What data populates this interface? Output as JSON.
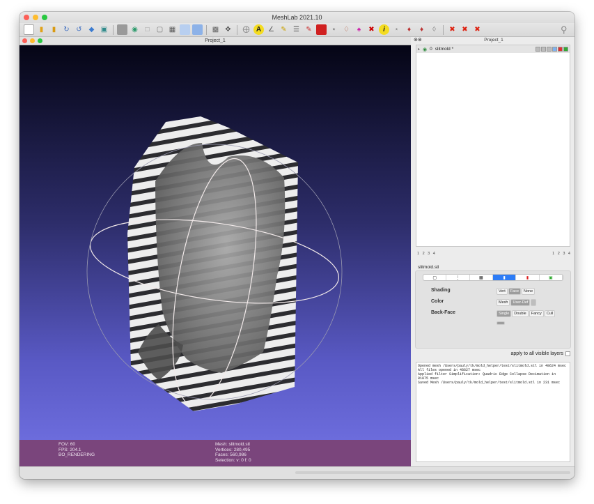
{
  "app": {
    "title": "MeshLab 2021.10"
  },
  "toolbar": {
    "icons": [
      "new-icon",
      "open-icon",
      "open-project-icon",
      "reload-icon",
      "reload-all-icon",
      "import-icon",
      "snapshot-icon",
      "points-icon",
      "wireframe-icon",
      "hidden-lines-icon",
      "flat-icon",
      "smooth-icon",
      "texture-icon",
      "box-icon",
      "bbox-icon",
      "lighting-icon",
      "align-icon",
      "annotation-icon",
      "measure-icon",
      "pick-icon",
      "paint-icon",
      "select-faces-icon",
      "select-vertices-icon",
      "z-paint-icon",
      "color-icon",
      "info-icon",
      "select-connected-icon",
      "delete-faces-icon",
      "delete-vertices-icon",
      "delete-all-icon",
      "x-icon",
      "search-icon"
    ]
  },
  "viewport": {
    "title": "Project_1",
    "info_left": [
      "FOV: 60",
      "FPS:   204.1",
      "BO_RENDERING"
    ],
    "info_right": [
      "Mesh: slitmold.stl",
      "Vertices: 280,495",
      "Faces: 560,986",
      "Selection: v: 0 f: 0"
    ]
  },
  "layers_panel": {
    "title": "Project_1",
    "layer": {
      "index": "0",
      "name": "slitmold *"
    },
    "pages_left": "1 2 3 4",
    "pages_right": "1 2 3 4"
  },
  "decorator": {
    "label": "slitmold.stl",
    "shading_label": "Shading",
    "shading_options": [
      "Vert",
      "Face",
      "None"
    ],
    "color_label": "Color",
    "color_options": [
      "Mesh",
      "User-Def"
    ],
    "backface_label": "Back-Face",
    "backface_options": [
      "Single",
      "Double",
      "Fancy",
      "Cull"
    ],
    "apply_label": "apply to all visible layers"
  },
  "log": {
    "lines": [
      "Opened mesh /Users/pauly/tk/mold_helper/test/slitmold.stl in 48624 msec",
      "All files opened in 48627 msec",
      "Applied filter Simplification: Quadric Edge Collapse Decimation in 81875 msec",
      "Saved Mesh /Users/pauly/tk/mold_helper/test/slitmold.stl in 231 msec"
    ]
  },
  "colors": {
    "infobar": "#7a457c",
    "viewport_top": "#050515",
    "viewport_bottom": "#6c6cdc",
    "accent": "#2d7cf6"
  }
}
